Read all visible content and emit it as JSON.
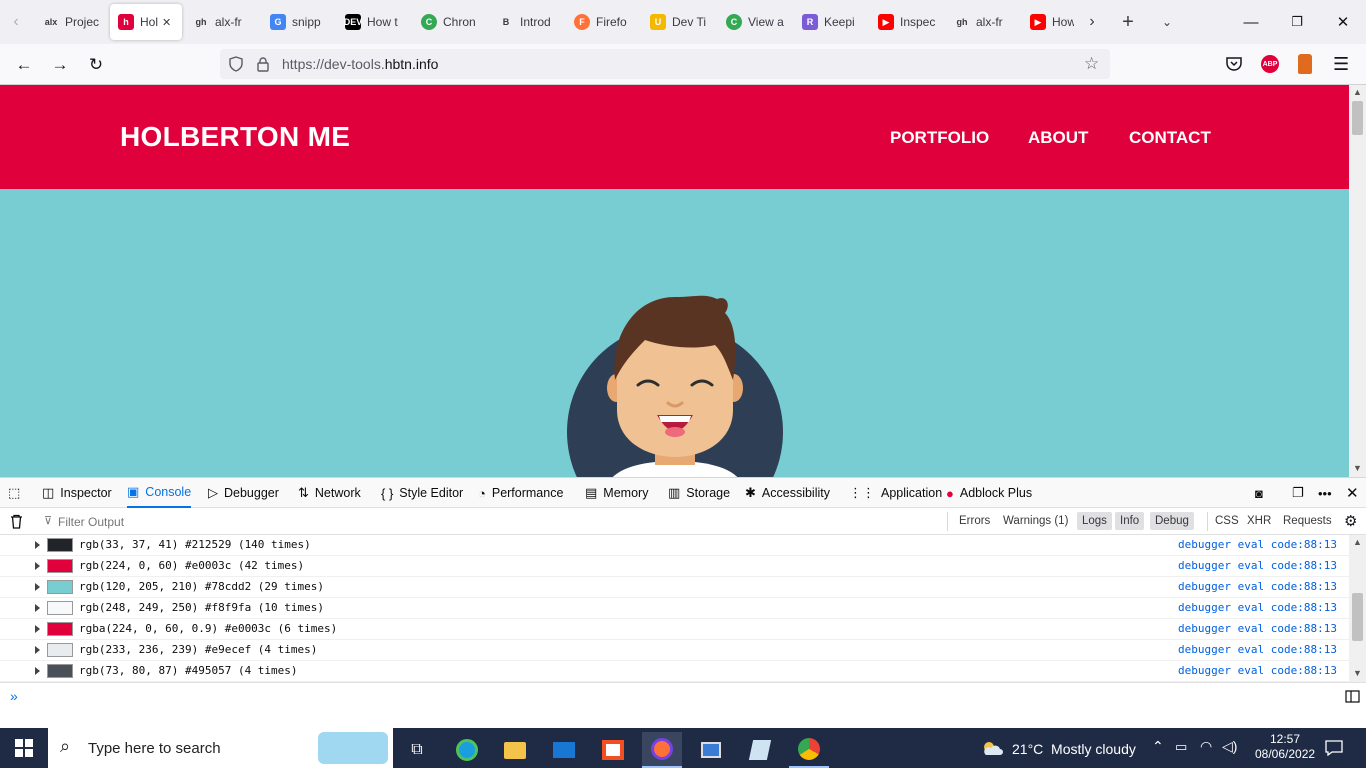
{
  "tabs": [
    {
      "label": "Projec",
      "icon": "alx-icon",
      "glyph": "alx"
    },
    {
      "label": "Hol",
      "icon": "holberton-icon",
      "glyph": "h",
      "active": true
    },
    {
      "label": "alx-fr",
      "icon": "github-icon",
      "glyph": "gh"
    },
    {
      "label": "snipp",
      "icon": "google-icon",
      "glyph": "G"
    },
    {
      "label": "How t",
      "icon": "dev-icon",
      "glyph": "DEV"
    },
    {
      "label": "Chron",
      "icon": "chrome-icon",
      "glyph": "C"
    },
    {
      "label": "Introd",
      "icon": "book-icon",
      "glyph": "B"
    },
    {
      "label": "Firefo",
      "icon": "firefox-icon",
      "glyph": "F"
    },
    {
      "label": "Dev Ti",
      "icon": "udemy-icon",
      "glyph": "U"
    },
    {
      "label": "View a",
      "icon": "chrome-icon",
      "glyph": "C"
    },
    {
      "label": "Keepi",
      "icon": "rocket-icon",
      "glyph": "R"
    },
    {
      "label": "Inspec",
      "icon": "youtube-icon",
      "glyph": "▶"
    },
    {
      "label": "alx-fr",
      "icon": "github-icon",
      "glyph": "gh"
    },
    {
      "label": "How",
      "icon": "youtube-icon",
      "glyph": "▶"
    }
  ],
  "url": {
    "prefix": "https://dev-tools.",
    "domain": "hbtn.info"
  },
  "site": {
    "title": "HOLBERTON ME",
    "nav": [
      "PORTFOLIO",
      "ABOUT",
      "CONTACT"
    ]
  },
  "devtools": {
    "tabs": [
      {
        "label": "Inspector",
        "icon": "inspector-icon"
      },
      {
        "label": "Console",
        "icon": "console-icon",
        "active": true
      },
      {
        "label": "Debugger",
        "icon": "debugger-icon"
      },
      {
        "label": "Network",
        "icon": "network-icon"
      },
      {
        "label": "Style Editor",
        "icon": "style-editor-icon"
      },
      {
        "label": "Performance",
        "icon": "performance-icon"
      },
      {
        "label": "Memory",
        "icon": "memory-icon"
      },
      {
        "label": "Storage",
        "icon": "storage-icon"
      },
      {
        "label": "Accessibility",
        "icon": "accessibility-icon"
      },
      {
        "label": "Application",
        "icon": "application-icon"
      },
      {
        "label": "Adblock Plus",
        "icon": "adblock-icon"
      }
    ],
    "filter_placeholder": "Filter Output",
    "filters": [
      {
        "label": "Errors",
        "on": false
      },
      {
        "label": "Warnings (1)",
        "on": false
      },
      {
        "label": "Logs",
        "on": true
      },
      {
        "label": "Info",
        "on": true
      },
      {
        "label": "Debug",
        "on": true
      },
      {
        "label": "CSS",
        "on": false
      },
      {
        "label": "XHR",
        "on": false
      },
      {
        "label": "Requests",
        "on": false
      }
    ],
    "console_rows": [
      {
        "text": "rgb(33, 37, 41) #212529 (140 times)",
        "color": "#212529",
        "source": "debugger eval code:88:13"
      },
      {
        "text": "rgb(224, 0, 60) #e0003c (42 times)",
        "color": "#e0003c",
        "source": "debugger eval code:88:13"
      },
      {
        "text": "rgb(120, 205, 210) #78cdd2 (29 times)",
        "color": "#78cdd2",
        "source": "debugger eval code:88:13"
      },
      {
        "text": "rgb(248, 249, 250) #f8f9fa (10 times)",
        "color": "#f8f9fa",
        "source": "debugger eval code:88:13"
      },
      {
        "text": "rgba(224, 0, 60, 0.9) #e0003c (6 times)",
        "color": "#e0003c",
        "source": "debugger eval code:88:13"
      },
      {
        "text": "rgb(233, 236, 239) #e9ecef (4 times)",
        "color": "#e9ecef",
        "source": "debugger eval code:88:13"
      },
      {
        "text": "rgb(73, 80, 87) #495057 (4 times)",
        "color": "#495057",
        "source": "debugger eval code:88:13"
      }
    ]
  },
  "taskbar": {
    "search_placeholder": "Type here to search",
    "weather": "21°C  Mostly cloudy",
    "time": "12:57",
    "date": "08/06/2022"
  },
  "colors": {
    "brand_red": "#e0003c",
    "teal": "#78cdd2",
    "accent_blue": "#0074e8"
  }
}
